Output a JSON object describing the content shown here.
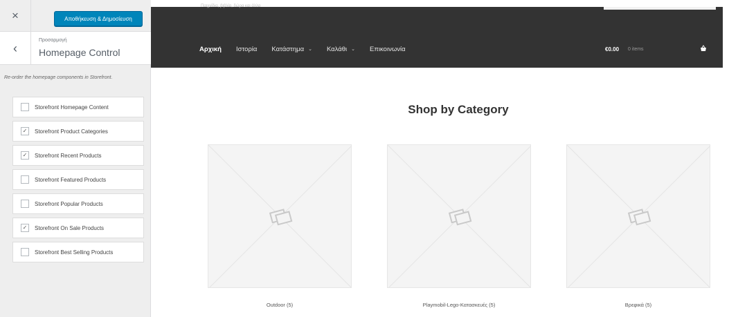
{
  "customizer": {
    "close_symbol": "×",
    "publish_label": "Αποθήκευση & Δημοσίευση",
    "back_symbol": "‹",
    "section_small": "Προσαρμογή",
    "section_title": "Homepage Control",
    "description": "Re-order the homepage components in Storefront.",
    "components": [
      {
        "label": "Storefront Homepage Content",
        "checked": false
      },
      {
        "label": "Storefront Product Categories",
        "checked": true
      },
      {
        "label": "Storefront Recent Products",
        "checked": true
      },
      {
        "label": "Storefront Featured Products",
        "checked": false
      },
      {
        "label": "Storefront Popular Products",
        "checked": false
      },
      {
        "label": "Storefront On Sale Products",
        "checked": true
      },
      {
        "label": "Storefront Best Selling Products",
        "checked": false
      }
    ]
  },
  "site": {
    "tagline": "Παιχνίδια, βιβλία, δώρα και άλλα",
    "nav": [
      {
        "label": "Αρχική",
        "active": true,
        "dropdown": false
      },
      {
        "label": "Ιστορία",
        "active": false,
        "dropdown": false
      },
      {
        "label": "Κατάστημα",
        "active": false,
        "dropdown": true
      },
      {
        "label": "Καλάθι",
        "active": false,
        "dropdown": true
      },
      {
        "label": "Επικοινωνία",
        "active": false,
        "dropdown": false
      }
    ],
    "dropdown_symbol": "⌄",
    "cart_amount": "€0.00",
    "cart_items": "0 items"
  },
  "main": {
    "section_title": "Shop by Category",
    "categories": [
      {
        "name": "Outdoor (5)"
      },
      {
        "name": "Playmobil-Lego-Κατασκευές (5)"
      },
      {
        "name": "Βρεφικά (5)"
      }
    ]
  },
  "colors": {
    "header_bg": "#333333",
    "publish_bg": "#0085ba",
    "sidebar_bg": "#eeeeee"
  },
  "icons": {
    "close": "close-icon",
    "back": "chevron-left-icon",
    "cart": "basket-icon",
    "placeholder": "image-placeholder-icon",
    "checkbox": "checkmark-icon"
  }
}
